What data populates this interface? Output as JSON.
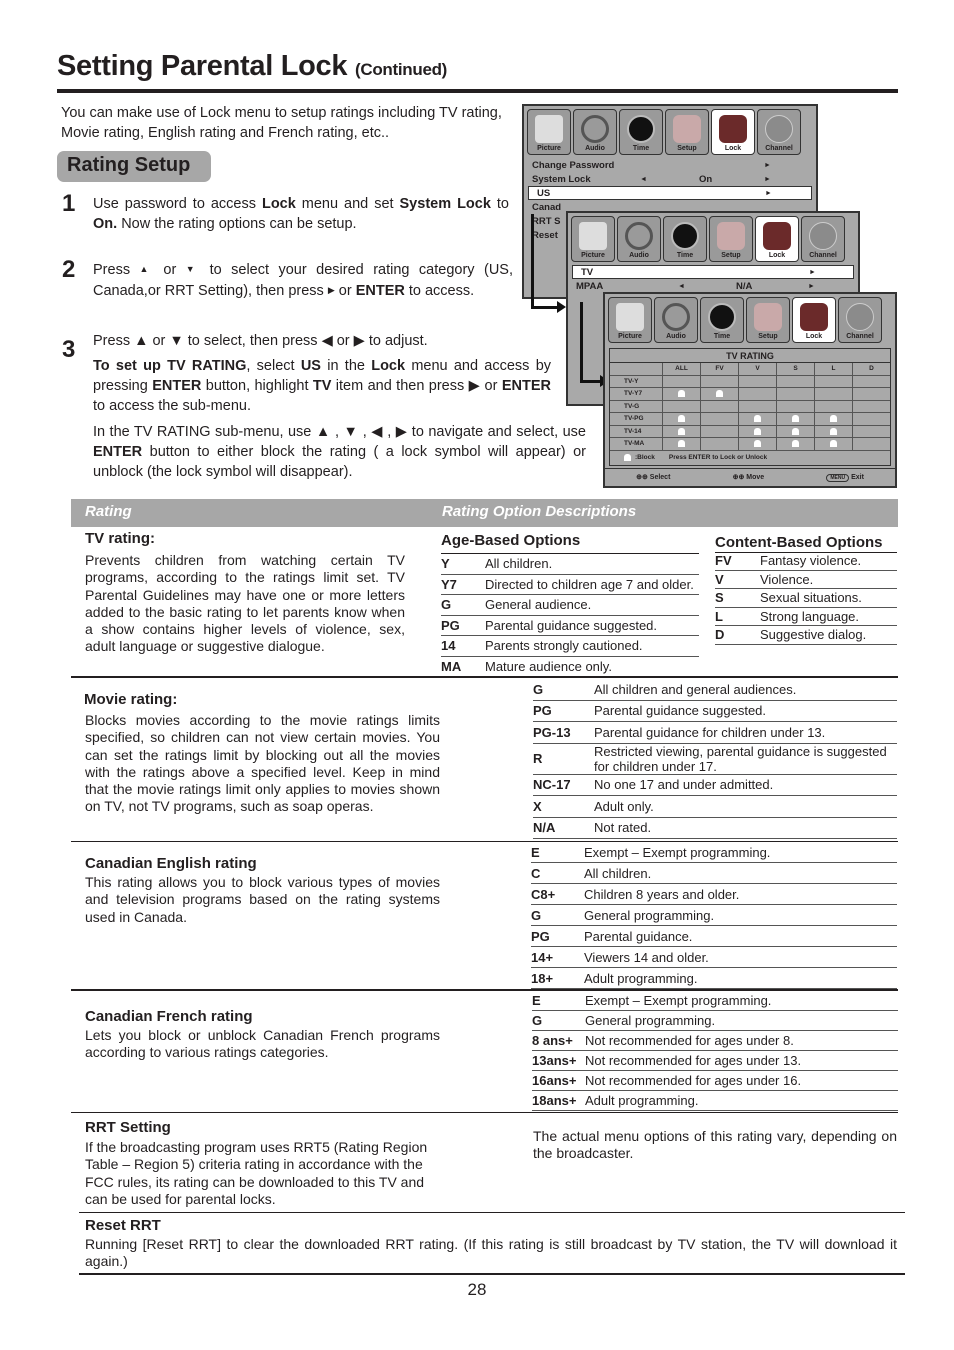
{
  "header": {
    "title": "Setting Parental Lock",
    "title_suffix": "(Continued)"
  },
  "intro": "You can make use of Lock menu to setup ratings including TV rating, Movie rating, English rating and French rating, etc..",
  "section_badge": "Rating Setup",
  "steps": [
    {
      "num": "1",
      "html_parts": [
        "Use password to access ",
        "Lock",
        " menu and set ",
        "System Lock",
        " to ",
        "On.",
        " Now the rating options can be setup."
      ]
    },
    {
      "num": "2",
      "text_a": "Press ",
      "up": "▲",
      "or1": " or ",
      "down": "▼",
      "text_b": "  to select your desired rating category (US, Canada,or RRT Setting), then press ",
      "right": "▶",
      "or2": " or ",
      "enter": "ENTER",
      "text_c": " to access."
    },
    {
      "num": "3",
      "line1": "Press ▲ or ▼ to select, then press ◀ or ▶ to adjust.",
      "p2_parts": [
        "To set up TV RATING",
        ", select ",
        "US",
        " in the ",
        "Lock",
        " menu and access by pressing ",
        "ENTER",
        " button, highlight ",
        "TV",
        " item and then press ▶ or ",
        "ENTER",
        " to access the sub-menu."
      ],
      "p3_parts": [
        "In the TV RATING sub-menu, use ▲ , ▼ , ◀ , ▶  to navigate and select, use ",
        "ENTER",
        " button to either block the rating  ( a lock symbol will appear) or unblock (the lock symbol will disappear)."
      ]
    }
  ],
  "tv_menu": {
    "icons": [
      "Picture",
      "Audio",
      "Time",
      "Setup",
      "Lock",
      "Channel"
    ],
    "selected_icon": "Lock",
    "lock_menu": {
      "items": [
        {
          "label": "Change Password",
          "value": ""
        },
        {
          "label": "System Lock",
          "value": "On"
        },
        {
          "label": "US",
          "value": ""
        },
        {
          "label": "Canad",
          "value": ""
        },
        {
          "label": "RRT S",
          "value": ""
        },
        {
          "label": "Reset",
          "value": ""
        }
      ]
    },
    "us_menu": {
      "items": [
        {
          "label": "TV",
          "value": ""
        },
        {
          "label": "MPAA",
          "value": "N/A"
        }
      ]
    },
    "tv_rating": {
      "title": "TV RATING",
      "columns": [
        "ALL",
        "FV",
        "V",
        "S",
        "L",
        "D"
      ],
      "rows": [
        {
          "label": "TV-Y",
          "locks": [
            false,
            false,
            false,
            false,
            false,
            false
          ]
        },
        {
          "label": "TV-Y7",
          "locks": [
            true,
            true,
            false,
            false,
            false,
            false
          ]
        },
        {
          "label": "TV-G",
          "locks": [
            false,
            false,
            false,
            false,
            false,
            false
          ]
        },
        {
          "label": "TV-PG",
          "locks": [
            true,
            false,
            true,
            true,
            true,
            false
          ]
        },
        {
          "label": "TV-14",
          "locks": [
            true,
            false,
            true,
            true,
            true,
            false
          ]
        },
        {
          "label": "TV-MA",
          "locks": [
            true,
            false,
            true,
            true,
            true,
            false
          ]
        }
      ],
      "legend_block": ":Block",
      "legend_hint": "Press ENTER to Lock or Unlock",
      "footer": {
        "select": "Select",
        "move": "Move",
        "menu": "MENU",
        "exit": "Exit"
      }
    }
  },
  "table": {
    "col1_header": "Rating",
    "col2_header": "Rating Option Descriptions",
    "tv": {
      "title": "TV rating:",
      "text": "Prevents children from watching certain TV programs, according to the ratings limit set.  TV Parental Guidelines may have one or more letters added to the basic rating to let parents know when a show contains higher levels of violence, sex, adult language or suggestive dialogue.",
      "age_title": "Age-Based Options",
      "age": [
        {
          "code": "Y",
          "desc": "All children."
        },
        {
          "code": "Y7",
          "desc": "Directed to children age 7 and older."
        },
        {
          "code": "G",
          "desc": "General audience."
        },
        {
          "code": "PG",
          "desc": "Parental guidance suggested."
        },
        {
          "code": "14",
          "desc": "Parents strongly cautioned."
        },
        {
          "code": "MA",
          "desc": "Mature audience only."
        }
      ],
      "content_title": "Content-Based Options",
      "content": [
        {
          "code": "FV",
          "desc": "Fantasy violence."
        },
        {
          "code": "V",
          "desc": "Violence."
        },
        {
          "code": "S",
          "desc": "Sexual situations."
        },
        {
          "code": "L",
          "desc": "Strong language."
        },
        {
          "code": "D",
          "desc": "Suggestive dialog."
        }
      ]
    },
    "movie": {
      "title": "Movie rating:",
      "text": "Blocks movies according to the movie ratings limits specified, so children can not view certain movies. You can set the ratings limit by blocking out all the movies with the ratings above a specified level. Keep in mind that the movie ratings limit only applies to movies shown on TV, not TV programs, such as soap operas.",
      "items": [
        {
          "code": "G",
          "desc": "All children and general audiences."
        },
        {
          "code": "PG",
          "desc": "Parental guidance suggested."
        },
        {
          "code": "PG-13",
          "desc": "Parental guidance for children under 13."
        },
        {
          "code": "R",
          "desc": "Restricted viewing, parental guidance is suggested for children under 17."
        },
        {
          "code": "NC-17",
          "desc": "No one 17 and under admitted."
        },
        {
          "code": "X",
          "desc": "Adult only."
        },
        {
          "code": "N/A",
          "desc": "Not rated."
        }
      ]
    },
    "english": {
      "title": "Canadian English rating",
      "text": "This rating allows you to block various types of movies and television programs based on the rating systems used in Canada.",
      "items": [
        {
          "code": "E",
          "desc": "Exempt – Exempt programming."
        },
        {
          "code": "C",
          "desc": "All children."
        },
        {
          "code": "C8+",
          "desc": "Children 8 years and older."
        },
        {
          "code": "G",
          "desc": "General programming."
        },
        {
          "code": "PG",
          "desc": "Parental guidance."
        },
        {
          "code": "14+",
          "desc": "Viewers 14 and older."
        },
        {
          "code": "18+",
          "desc": "Adult programming."
        }
      ]
    },
    "french": {
      "title": "Canadian French rating",
      "text": "Lets you block or unblock Canadian French programs according to various ratings categories.",
      "items": [
        {
          "code": "E",
          "desc": "Exempt – Exempt programming."
        },
        {
          "code": "G",
          "desc": "General programming."
        },
        {
          "code": "8 ans+",
          "desc": "Not recommended for ages under 8."
        },
        {
          "code": "13ans+",
          "desc": "Not recommended for ages under 13."
        },
        {
          "code": "16ans+",
          "desc": "Not recommended for ages under 16."
        },
        {
          "code": "18ans+",
          "desc": "Adult programming."
        }
      ]
    },
    "rrt": {
      "title": "RRT Setting",
      "text": "If the broadcasting program uses RRT5 (Rating Region Table – Region 5) criteria rating in accordance with the FCC rules, its rating can be downloaded to this TV and can be used for parental locks.",
      "note": "The actual menu options of this rating vary, depending on the broadcaster."
    },
    "reset": {
      "title": "Reset RRT",
      "text": "Running [Reset RRT] to clear the downloaded RRT rating. (If this rating is still broadcast by TV station, the TV will download it again.)"
    }
  },
  "page_number": "28"
}
